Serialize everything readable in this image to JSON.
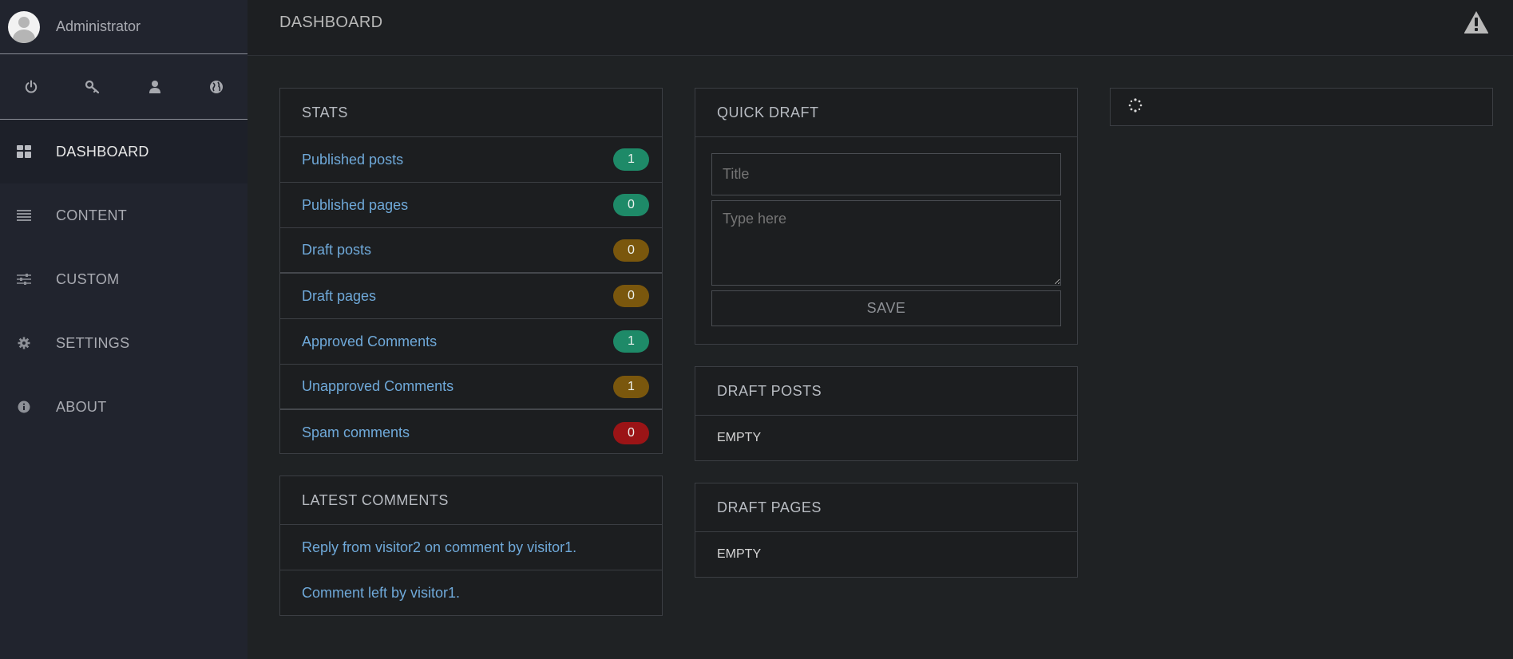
{
  "sidebar": {
    "user_name": "Administrator",
    "quick_icons": [
      "power-icon",
      "key-icon",
      "user-icon",
      "globe-icon"
    ],
    "nav": [
      {
        "label": "DASHBOARD",
        "icon": "dashboard-icon",
        "active": true
      },
      {
        "label": "CONTENT",
        "icon": "list-icon",
        "active": false
      },
      {
        "label": "CUSTOM",
        "icon": "sliders-icon",
        "active": false
      },
      {
        "label": "SETTINGS",
        "icon": "gear-icon",
        "active": false
      },
      {
        "label": "ABOUT",
        "icon": "info-icon",
        "active": false
      }
    ]
  },
  "topbar": {
    "title": "DASHBOARD",
    "alert_icon": "warning-icon"
  },
  "stats": {
    "title": "STATS",
    "rows": [
      {
        "label": "Published posts",
        "count": "1",
        "color": "#1e8a68"
      },
      {
        "label": "Published pages",
        "count": "0",
        "color": "#1e8a68"
      },
      {
        "label": "Draft posts",
        "count": "0",
        "color": "#7a570d"
      },
      {
        "label": "Draft pages",
        "count": "0",
        "color": "#7a570d"
      },
      {
        "label": "Approved Comments",
        "count": "1",
        "color": "#1e8a68"
      },
      {
        "label": "Unapproved Comments",
        "count": "1",
        "color": "#7a570d"
      },
      {
        "label": "Spam comments",
        "count": "0",
        "color": "#9b1416"
      }
    ]
  },
  "latest_comments": {
    "title": "LATEST COMMENTS",
    "items": [
      "Reply from visitor2 on comment by visitor1.",
      "Comment left by visitor1."
    ]
  },
  "quick_draft": {
    "title": "QUICK DRAFT",
    "title_placeholder": "Title",
    "body_placeholder": "Type here",
    "save_label": "SAVE"
  },
  "draft_posts": {
    "title": "DRAFT POSTS",
    "empty_label": "EMPTY"
  },
  "draft_pages": {
    "title": "DRAFT PAGES",
    "empty_label": "EMPTY"
  },
  "loader": {
    "icon": "spinner-icon"
  }
}
